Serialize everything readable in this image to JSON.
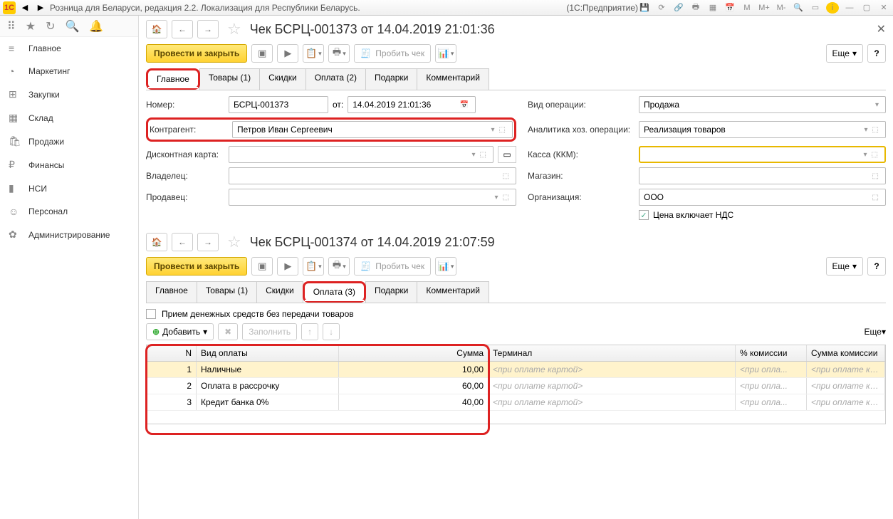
{
  "app": {
    "logo": "1C",
    "title": "Розница для Беларуси, редакция 2.2. Локализация для Республики Беларусь.",
    "suffix": "(1С:Предприятие)"
  },
  "nav": {
    "items": [
      {
        "icon": "≡",
        "label": "Главное"
      },
      {
        "icon": "◔",
        "label": "Маркетинг"
      },
      {
        "icon": "⊞",
        "label": "Закупки"
      },
      {
        "icon": "▦",
        "label": "Склад"
      },
      {
        "icon": "🛍",
        "label": "Продажи"
      },
      {
        "icon": "₽",
        "label": "Финансы"
      },
      {
        "icon": "▮",
        "label": "НСИ"
      },
      {
        "icon": "☺",
        "label": "Персонал"
      },
      {
        "icon": "✿",
        "label": "Администрирование"
      }
    ]
  },
  "doc1": {
    "title": "Чек БСРЦ-001373 от 14.04.2019 21:01:36",
    "post_close": "Провести и закрыть",
    "punch": "Пробить чек",
    "more": "Еще",
    "tabs": [
      "Главное",
      "Товары (1)",
      "Скидки",
      "Оплата (2)",
      "Подарки",
      "Комментарий"
    ],
    "labels": {
      "number": "Номер:",
      "from": "от:",
      "contractor": "Контрагент:",
      "discount": "Дисконтная карта:",
      "owner": "Владелец:",
      "seller": "Продавец:",
      "optype": "Вид операции:",
      "analytics": "Аналитика хоз. операции:",
      "kkm": "Касса (ККМ):",
      "store": "Магазин:",
      "org": "Организация:",
      "vat": "Цена включает НДС"
    },
    "values": {
      "number": "БСРЦ-001373",
      "date": "14.04.2019 21:01:36",
      "contractor": "Петров Иван Сергеевич",
      "optype": "Продажа",
      "analytics": "Реализация товаров",
      "org": "ООО"
    }
  },
  "doc2": {
    "title": "Чек БСРЦ-001374 от 14.04.2019 21:07:59",
    "post_close": "Провести и закрыть",
    "punch": "Пробить чек",
    "more": "Еще",
    "tabs": [
      "Главное",
      "Товары (1)",
      "Скидки",
      "Оплата (3)",
      "Подарки",
      "Комментарий"
    ],
    "check_label": "Прием денежных средств без передачи товаров",
    "add": "Добавить",
    "fill": "Заполнить",
    "cols": {
      "n": "N",
      "type": "Вид оплаты",
      "sum": "Сумма",
      "term": "Терминал",
      "pct": "% комиссии",
      "com": "Сумма комиссии"
    },
    "rows": [
      {
        "n": "1",
        "type": "Наличные",
        "sum": "10,00",
        "term": "<при оплате картой>",
        "pct": "<при опла...",
        "com": "<при оплате ка..."
      },
      {
        "n": "2",
        "type": "Оплата в рассрочку",
        "sum": "60,00",
        "term": "<при оплате картой>",
        "pct": "<при опла...",
        "com": "<при оплате ка..."
      },
      {
        "n": "3",
        "type": "Кредит банка 0%",
        "sum": "40,00",
        "term": "<при оплате картой>",
        "pct": "<при опла...",
        "com": "<при оплате ка..."
      }
    ]
  }
}
